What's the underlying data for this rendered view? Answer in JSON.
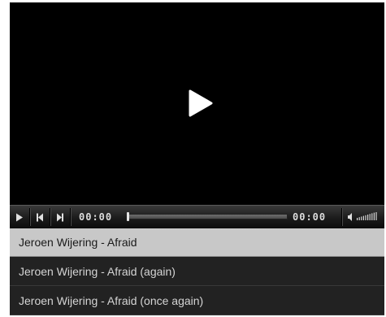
{
  "player": {
    "state": "paused",
    "big_play_icon": "play-icon",
    "colors": {
      "background": "#000000",
      "controlbar": "#1b1b1b",
      "text": "#dcdcdc",
      "active_item_bg": "#c8c8c8"
    }
  },
  "controlbar": {
    "play_icon": "play-icon",
    "prev_icon": "skip-previous-icon",
    "next_icon": "skip-next-icon",
    "elapsed": "00:00",
    "duration": "00:00",
    "progress": 0,
    "volume_icon": "volume-icon",
    "volume_level": 1
  },
  "playlist": {
    "active_index": 0,
    "items": [
      {
        "title": "Jeroen Wijering - Afraid"
      },
      {
        "title": "Jeroen Wijering - Afraid (again)"
      },
      {
        "title": "Jeroen Wijering - Afraid (once again)"
      }
    ]
  }
}
